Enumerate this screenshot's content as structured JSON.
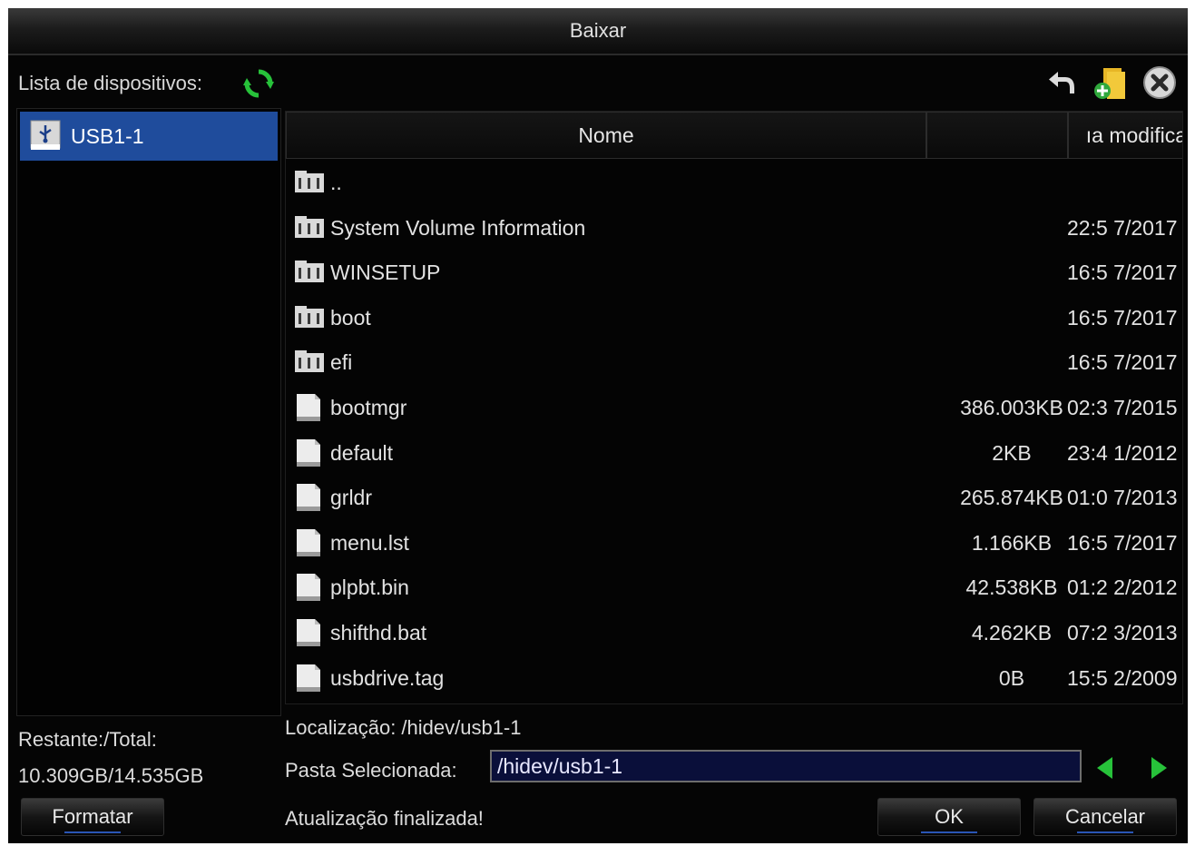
{
  "window": {
    "title": "Baixar"
  },
  "devices": {
    "label": "Lista de dispositivos:",
    "items": [
      {
        "label": "USB1-1"
      }
    ]
  },
  "table": {
    "headers": {
      "name": "Nome",
      "size": "",
      "date": "ıa modifica"
    },
    "rows": [
      {
        "type": "folder",
        "name": "..",
        "size": "",
        "date": ""
      },
      {
        "type": "folder",
        "name": "System Volume Information",
        "size": "",
        "date": "7/2017 22:5"
      },
      {
        "type": "folder",
        "name": "WINSETUP",
        "size": "",
        "date": "7/2017 16:5"
      },
      {
        "type": "folder",
        "name": "boot",
        "size": "",
        "date": "7/2017 16:5"
      },
      {
        "type": "folder",
        "name": "efi",
        "size": "",
        "date": "7/2017 16:5"
      },
      {
        "type": "file",
        "name": "bootmgr",
        "size": "386.003KB",
        "date": "7/2015 02:3"
      },
      {
        "type": "file",
        "name": "default",
        "size": "2KB",
        "date": "1/2012 23:4"
      },
      {
        "type": "file",
        "name": "grldr",
        "size": "265.874KB",
        "date": "7/2013 01:0"
      },
      {
        "type": "file",
        "name": "menu.lst",
        "size": "1.166KB",
        "date": "7/2017 16:5"
      },
      {
        "type": "file",
        "name": "plpbt.bin",
        "size": "42.538KB",
        "date": "2/2012 01:2"
      },
      {
        "type": "file",
        "name": "shifthd.bat",
        "size": "4.262KB",
        "date": "3/2013 07:2"
      },
      {
        "type": "file",
        "name": "usbdrive.tag",
        "size": "0B",
        "date": "2/2009 15:5"
      }
    ]
  },
  "storage": {
    "label": "Restante:/Total:",
    "value": "10.309GB/14.535GB"
  },
  "location": {
    "text": "Localização: /hidev/usb1-1"
  },
  "selected_folder": {
    "label": "Pasta Selecionada:",
    "value": "/hidev/usb1-1"
  },
  "status": {
    "text": "Atualização finalizada!"
  },
  "buttons": {
    "format": "Formatar",
    "ok": "OK",
    "cancel": "Cancelar"
  },
  "icons": {
    "refresh": "refresh-icon",
    "back": "back-arrow-icon",
    "new_folder": "new-folder-icon",
    "close": "close-icon",
    "usb": "usb-drive-icon",
    "folder": "folder-icon",
    "file": "file-icon",
    "prev": "arrow-left-icon",
    "next": "arrow-right-icon"
  },
  "colors": {
    "selection": "#1f4c9c",
    "accent_green": "#27c23a",
    "input_bg": "#0a0f3a"
  }
}
